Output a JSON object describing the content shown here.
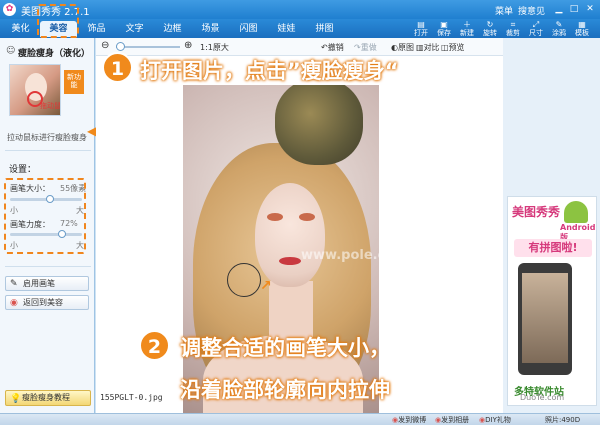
{
  "app": {
    "title": "美图秀秀 2.7.1",
    "menu": "菜单",
    "user": "搜意见"
  },
  "tabs": [
    {
      "label": "美化",
      "active": false
    },
    {
      "label": "美容",
      "active": true
    },
    {
      "label": "饰品",
      "active": false
    },
    {
      "label": "文字",
      "active": false
    },
    {
      "label": "边框",
      "active": false
    },
    {
      "label": "场景",
      "active": false
    },
    {
      "label": "闪图",
      "active": false
    },
    {
      "label": "娃娃",
      "active": false
    },
    {
      "label": "拼图",
      "active": false
    }
  ],
  "tools": [
    {
      "label": "打开",
      "icon": "folder-icon"
    },
    {
      "label": "保存",
      "icon": "save-icon"
    },
    {
      "label": "新建",
      "icon": "new-icon"
    },
    {
      "label": "旋转",
      "icon": "rotate-icon"
    },
    {
      "label": "裁剪",
      "icon": "crop-icon"
    },
    {
      "label": "尺寸",
      "icon": "resize-icon"
    },
    {
      "label": "涂鸦",
      "icon": "doodle-icon"
    },
    {
      "label": "模板",
      "icon": "template-icon"
    }
  ],
  "left_panel": {
    "title": "瘦脸瘦身（液化）",
    "new_badge": "新功能",
    "thumb_caption": "拖动鼠标",
    "description": "拉动鼠标进行瘦脸瘦身",
    "settings_title": "设置：",
    "brush_size": {
      "label": "画笔大小：",
      "value": "55像素",
      "level": 0.55
    },
    "brush_strength": {
      "label": "画笔力度：",
      "value": "72%",
      "level": 0.72
    },
    "small": "小",
    "large": "大",
    "apply_button": "启用画笔",
    "back_button": "返回到美容",
    "tutorial_button": "瘦脸瘦身教程"
  },
  "canvas": {
    "zoom_label": "1:1原大",
    "undo": "撤销",
    "redo": "重做",
    "original": "原图",
    "compare": "对比",
    "preview": "预览",
    "filename": "155PGLT-0.jpg",
    "watermark": "www.pole.com"
  },
  "annotations": {
    "step1_number": "1",
    "step1_text": "打开图片，点击”瘦脸瘦身“",
    "step2_number": "2",
    "step2_line1": "调整合适的画笔大小，",
    "step2_line2": "沿着脸部轮廓向内拉伸"
  },
  "ad": {
    "brand": "美图秀秀",
    "platform": "Android版",
    "slogan": "有拼图啦!",
    "site": "多特软件站",
    "site_url": "DuoTe.com"
  },
  "status": {
    "weibo": "发到微博",
    "album": "发到相册",
    "shop": "DIY礼物",
    "size": "照片:490D"
  }
}
